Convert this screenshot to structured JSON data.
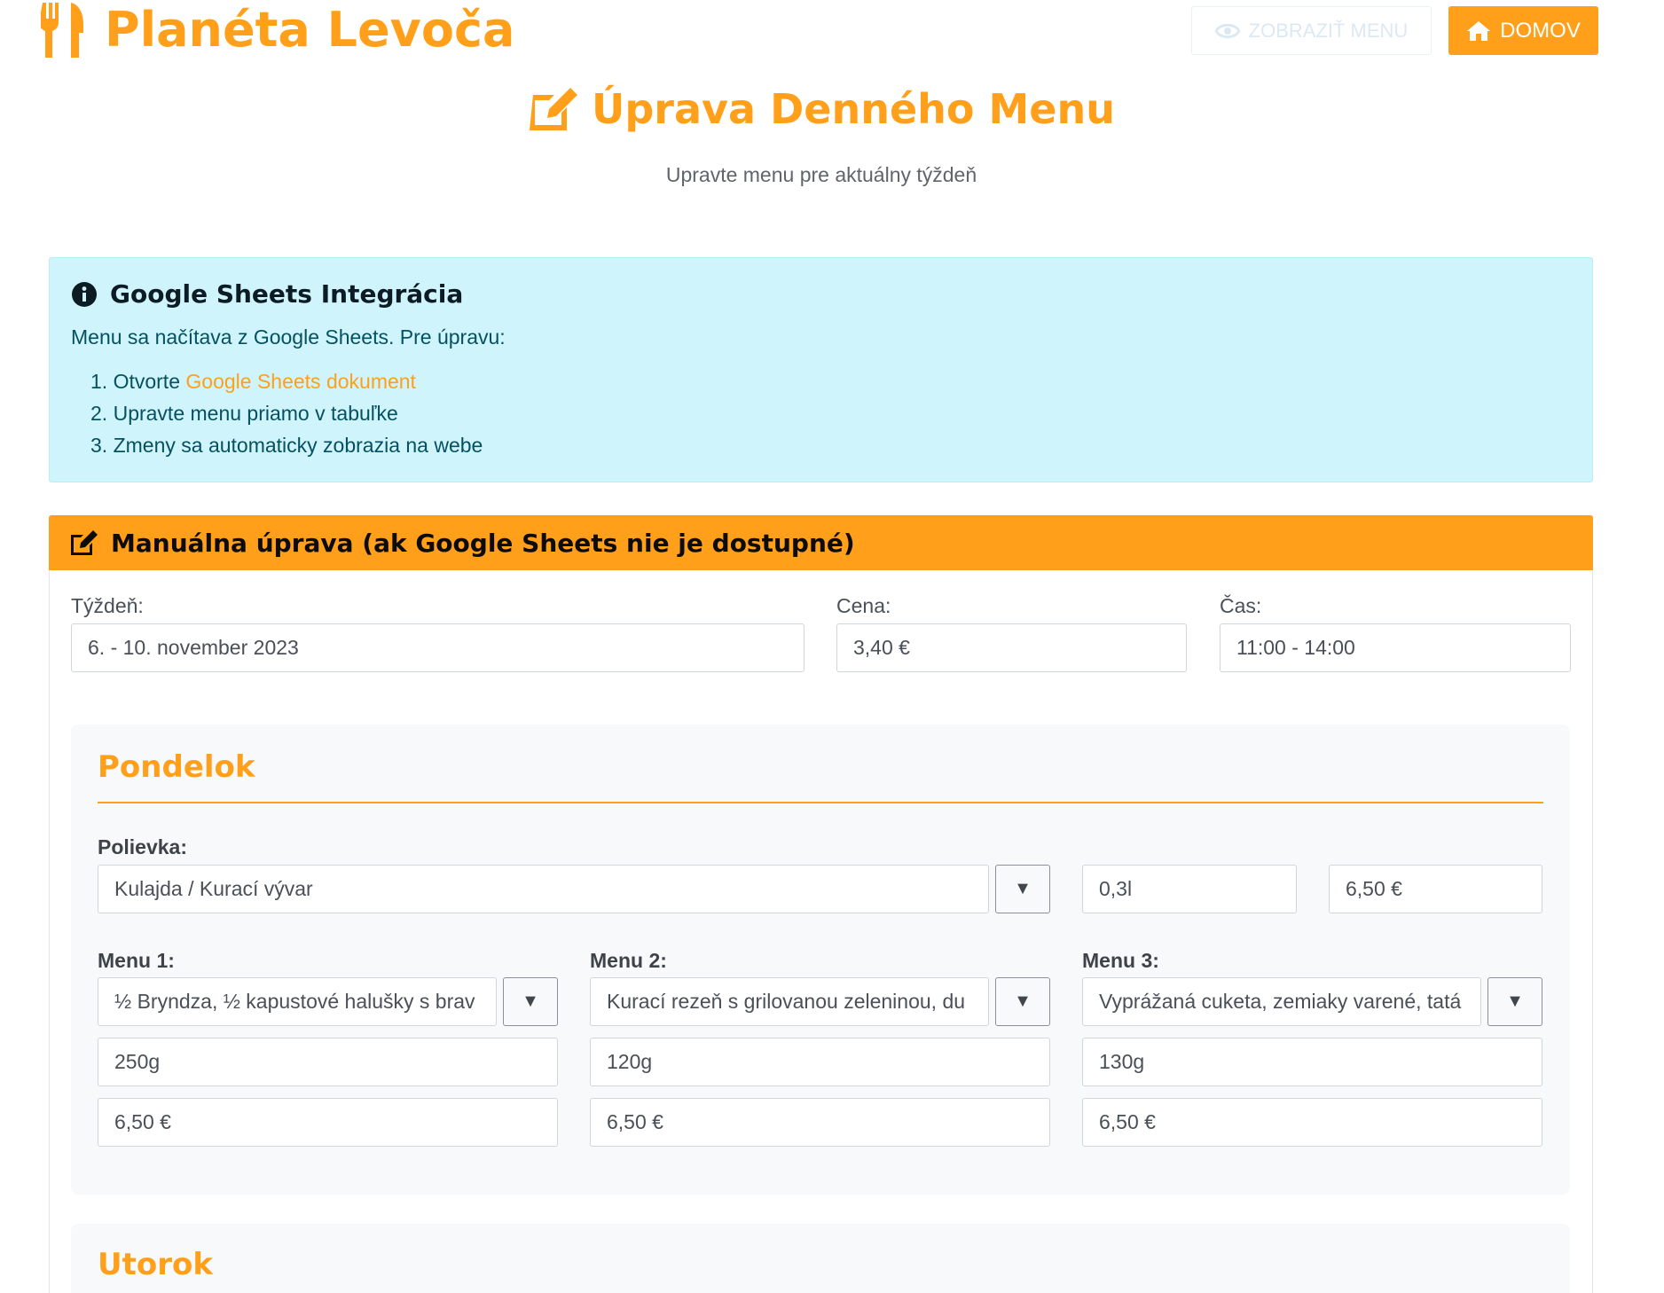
{
  "brand": {
    "name": "Planéta Levoča",
    "icon": "utensils-icon",
    "color": "#ff9f1a"
  },
  "nav": {
    "view_menu": {
      "label": "ZOBRAZIŤ MENU",
      "icon": "eye-icon"
    },
    "home": {
      "label": "DOMOV",
      "icon": "home-icon"
    }
  },
  "page": {
    "title": "Úprava Denného Menu",
    "title_icon": "edit-icon",
    "subtitle": "Upravte menu pre aktuálny týždeň"
  },
  "info": {
    "icon": "info-circle-icon",
    "title": "Google Sheets Integrácia",
    "text": "Menu sa načítava z Google Sheets. Pre úpravu:",
    "steps": [
      {
        "num": "1.",
        "prefix": "Otvorte ",
        "link": "Google Sheets dokument"
      },
      {
        "num": "2.",
        "text": "Upravte menu priamo v tabuľke"
      },
      {
        "num": "3.",
        "text": "Zmeny sa automaticky zobrazia na webe"
      }
    ]
  },
  "manual": {
    "icon": "edit-icon",
    "title": "Manuálna úprava (ak Google Sheets nie je dostupné)",
    "week": {
      "label": "Týždeň:",
      "value": "6. - 10. november 2023"
    },
    "price": {
      "label": "Cena:",
      "value": "3,40 €"
    },
    "time": {
      "label": "Čas:",
      "value": "11:00 - 14:00"
    }
  },
  "days": [
    {
      "name": "Pondelok",
      "soup": {
        "label": "Polievka:",
        "value": "Kulajda / Kurací vývar",
        "volume": "0,3l",
        "price": "6,50 €"
      },
      "menus": [
        {
          "label": "Menu 1:",
          "name": "½ Bryndza, ½ kapustové halušky s brav",
          "weight": "250g",
          "price": "6,50 €"
        },
        {
          "label": "Menu 2:",
          "name": "Kurací rezeň s grilovanou zeleninou, du",
          "weight": "120g",
          "price": "6,50 €"
        },
        {
          "label": "Menu 3:",
          "name": "Vyprážaná cuketa, zemiaky varené, tatá",
          "weight": "130g",
          "price": "6,50 €"
        }
      ]
    },
    {
      "name": "Utorok"
    }
  ],
  "dropdown_glyph": "▼"
}
